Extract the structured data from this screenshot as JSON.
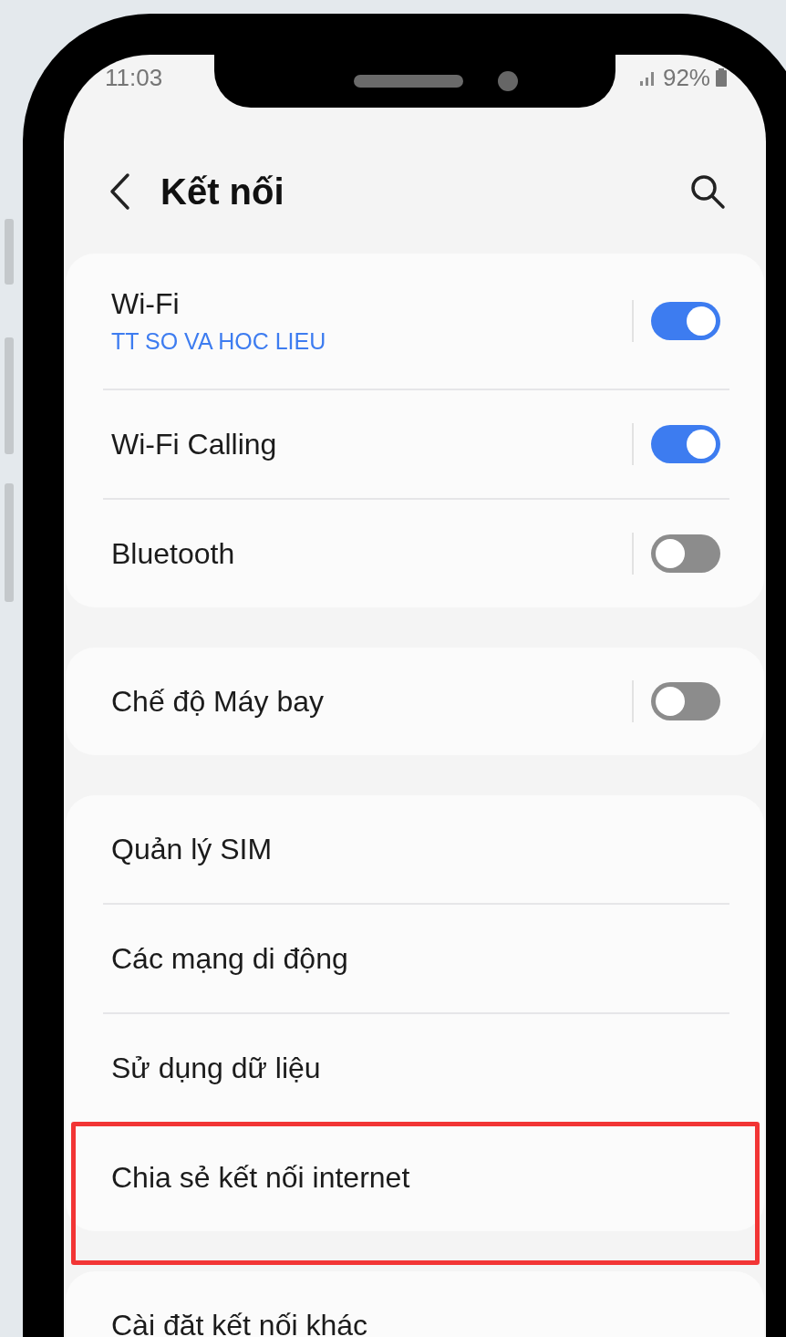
{
  "status_bar": {
    "time": "11:03",
    "battery": "92%"
  },
  "header": {
    "title": "Kết nối"
  },
  "groups": [
    {
      "items": [
        {
          "kind": "toggle",
          "label": "Wi-Fi",
          "subtitle": "TT SO VA HOC LIEU",
          "on": true,
          "highlighted": false
        },
        {
          "kind": "toggle",
          "label": "Wi-Fi Calling",
          "on": true,
          "highlighted": false
        },
        {
          "kind": "toggle",
          "label": "Bluetooth",
          "on": false,
          "highlighted": false
        }
      ]
    },
    {
      "items": [
        {
          "kind": "toggle",
          "label": "Chế độ Máy bay",
          "on": false,
          "highlighted": false
        }
      ]
    },
    {
      "items": [
        {
          "kind": "link",
          "label": "Quản lý SIM",
          "highlighted": false
        },
        {
          "kind": "link",
          "label": "Các mạng di động",
          "highlighted": false
        },
        {
          "kind": "link",
          "label": "Sử dụng dữ liệu",
          "highlighted": false
        },
        {
          "kind": "link",
          "label": "Chia sẻ kết nối internet",
          "highlighted": true
        }
      ]
    },
    {
      "items": [
        {
          "kind": "link",
          "label": "Cài đặt kết nối khác",
          "highlighted": false
        }
      ]
    }
  ]
}
